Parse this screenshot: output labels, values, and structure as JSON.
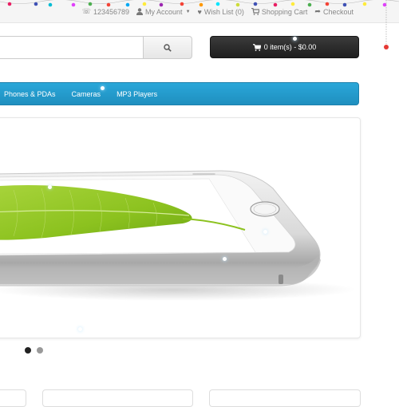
{
  "top_links": {
    "phone": "123456789",
    "account": "My Account",
    "wishlist": "Wish List (0)",
    "cart": "Shopping Cart",
    "checkout": "Checkout"
  },
  "search": {
    "value": "",
    "placeholder": ""
  },
  "cart_button": {
    "label": "0 item(s) - $0.00"
  },
  "nav": {
    "items": [
      "Phones & PDAs",
      "Cameras",
      "MP3 Players"
    ]
  },
  "slideshow": {
    "slide_count": 2,
    "active_index": 0
  },
  "colors": {
    "nav_blue": "#2aa7d9",
    "cart_dark": "#2b2b2b",
    "light_colors": [
      "#e91e63",
      "#3f51b5",
      "#00bcd4",
      "#ffeb3b",
      "#4caf50",
      "#f44336",
      "#9c27b0",
      "#03a9f4"
    ]
  },
  "icons": [
    "phone-icon",
    "user-icon",
    "heart-icon",
    "shopping-cart-icon",
    "share-icon",
    "search-icon",
    "cart-icon"
  ]
}
